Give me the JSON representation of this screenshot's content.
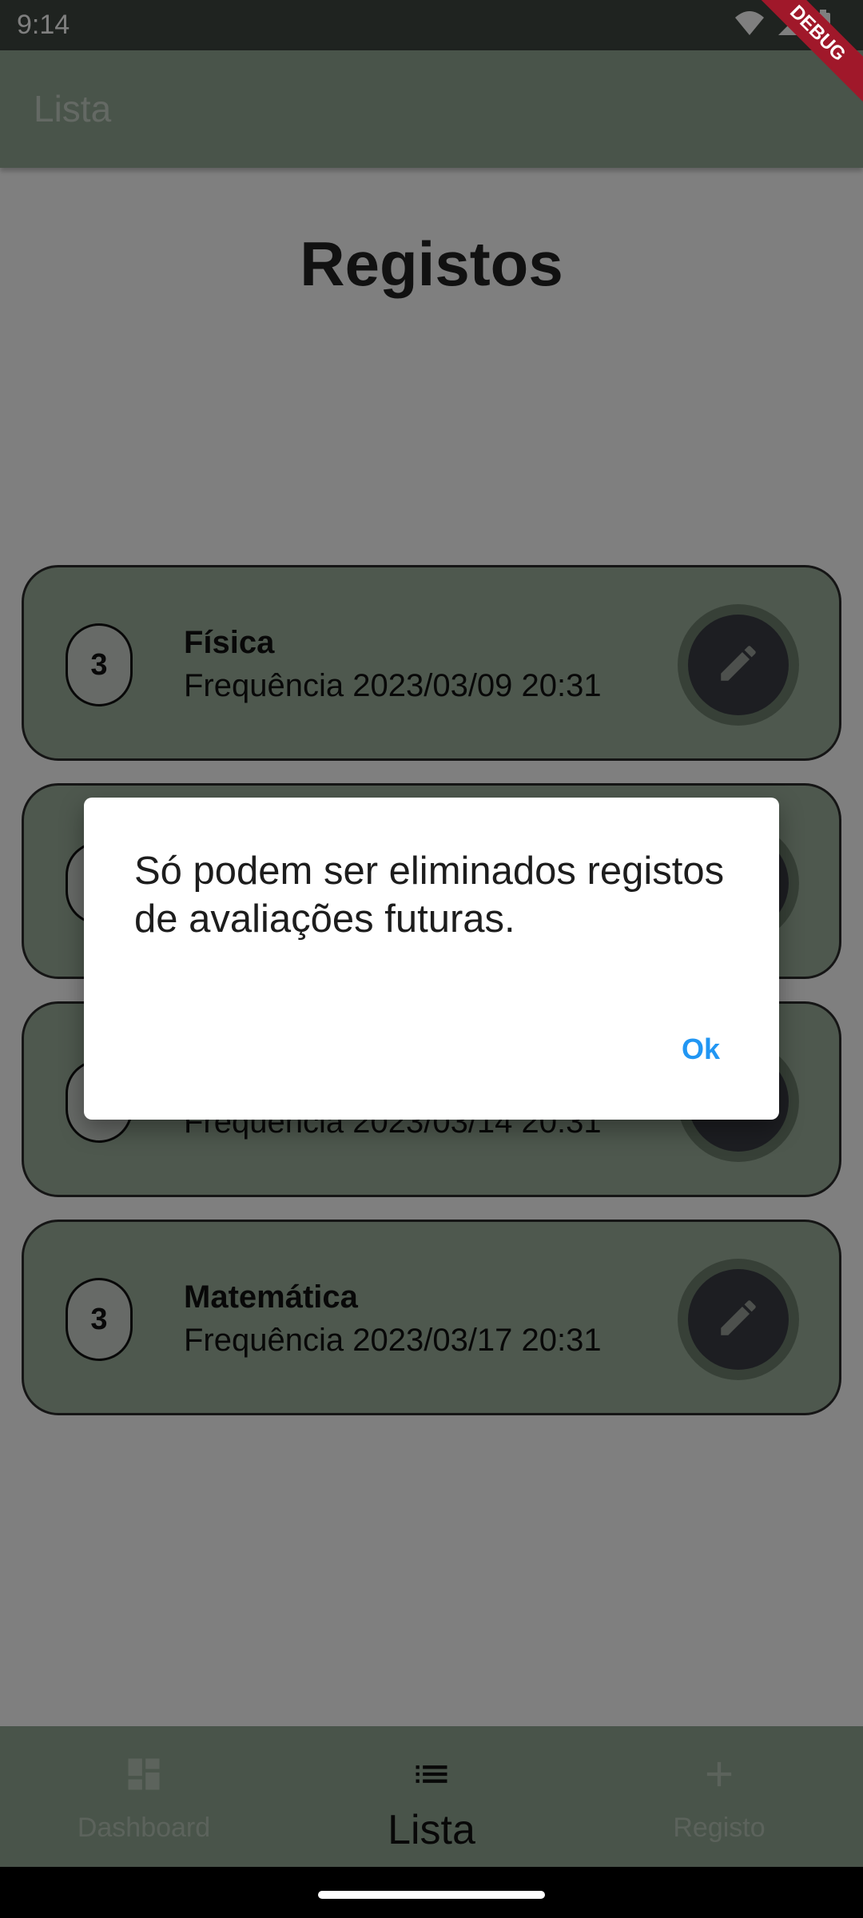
{
  "status_bar": {
    "time": "9:14"
  },
  "app_bar": {
    "title": "Lista"
  },
  "debug_banner": "DEBUG",
  "page": {
    "title": "Registos"
  },
  "cards": [
    {
      "badge": "3",
      "title": "Física",
      "subtitle": "Frequência  2023/03/09 20:31"
    },
    {
      "badge": "",
      "title": "",
      "subtitle": ""
    },
    {
      "badge": "",
      "title": "",
      "subtitle": "Frequência  2023/03/14 20:31"
    },
    {
      "badge": "3",
      "title": "Matemática",
      "subtitle": "Frequência  2023/03/17 20:31"
    }
  ],
  "dialog": {
    "message": "Só podem ser eliminados registos de avaliações futuras.",
    "ok_label": "Ok"
  },
  "bottom_nav": {
    "items": [
      {
        "label": "Dashboard",
        "icon": "dashboard-icon",
        "active": false
      },
      {
        "label": "Lista",
        "icon": "list-icon",
        "active": true
      },
      {
        "label": "Registo",
        "icon": "add-icon",
        "active": false
      }
    ]
  },
  "colors": {
    "app_bar": "#93a895",
    "card": "#9db19d",
    "edit_button": "#3a3d45",
    "dialog_action": "#2196f3",
    "debug_banner": "#a0182a"
  }
}
